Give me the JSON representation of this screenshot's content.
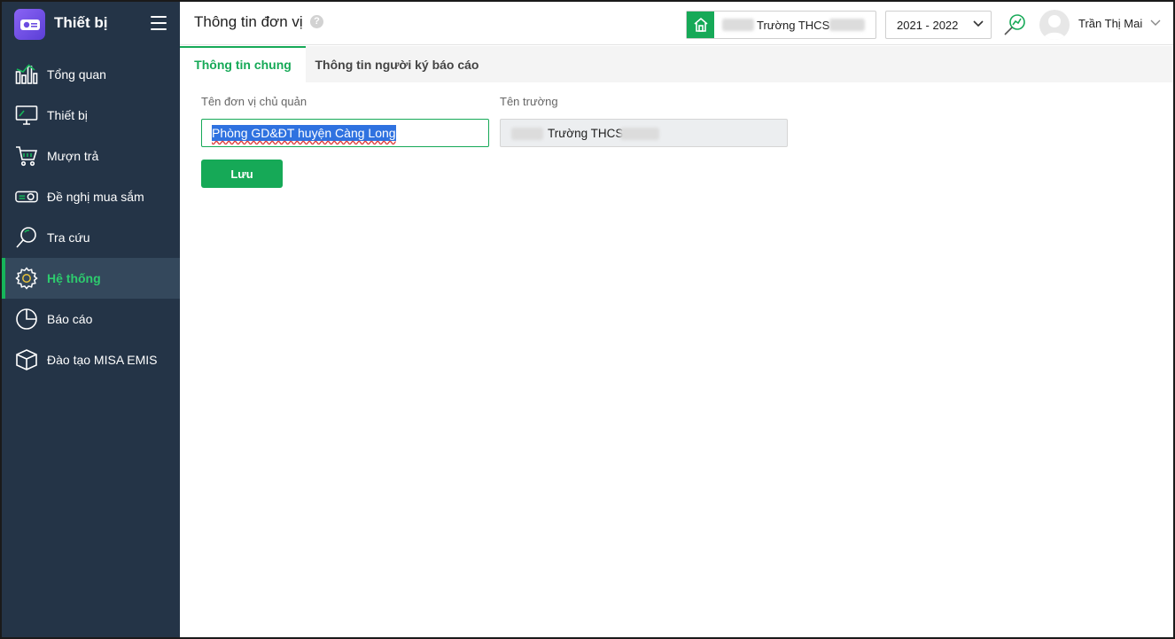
{
  "app": {
    "title": "Thiết bị"
  },
  "sidebar": {
    "items": [
      {
        "label": "Tổng quan",
        "icon": "dashboard-chart-icon",
        "active": false
      },
      {
        "label": "Thiết bị",
        "icon": "monitor-icon",
        "active": false
      },
      {
        "label": "Mượn trả",
        "icon": "cart-icon",
        "active": false
      },
      {
        "label": "Đề nghị mua sắm",
        "icon": "projector-icon",
        "active": false
      },
      {
        "label": "Tra cứu",
        "icon": "search-icon",
        "active": false
      },
      {
        "label": "Hệ thống",
        "icon": "gear-icon",
        "active": true
      },
      {
        "label": "Báo cáo",
        "icon": "pie-chart-icon",
        "active": false
      },
      {
        "label": "Đào tạo MISA EMIS",
        "icon": "box-icon",
        "active": false
      }
    ]
  },
  "header": {
    "page_title": "Thông tin đơn vị",
    "help_glyph": "?",
    "school_selector": {
      "name": "Trường THCS"
    },
    "year_selector": {
      "value": "2021 - 2022"
    },
    "user": {
      "name": "Trần Thị Mai"
    }
  },
  "tabs": [
    {
      "label": "Thông tin chung",
      "active": true
    },
    {
      "label": "Thông tin người ký báo cáo",
      "active": false
    }
  ],
  "form": {
    "unit_label": "Tên đơn vị chủ quản",
    "unit_value": "Phòng GD&ĐT huyện Càng Long",
    "school_label": "Tên trường",
    "school_value": "Trường THCS",
    "save_label": "Lưu"
  },
  "colors": {
    "sidebar_bg": "#243447",
    "accent_green": "#16a957",
    "active_text": "#2dcc6e",
    "selection_blue": "#2f72e0"
  }
}
